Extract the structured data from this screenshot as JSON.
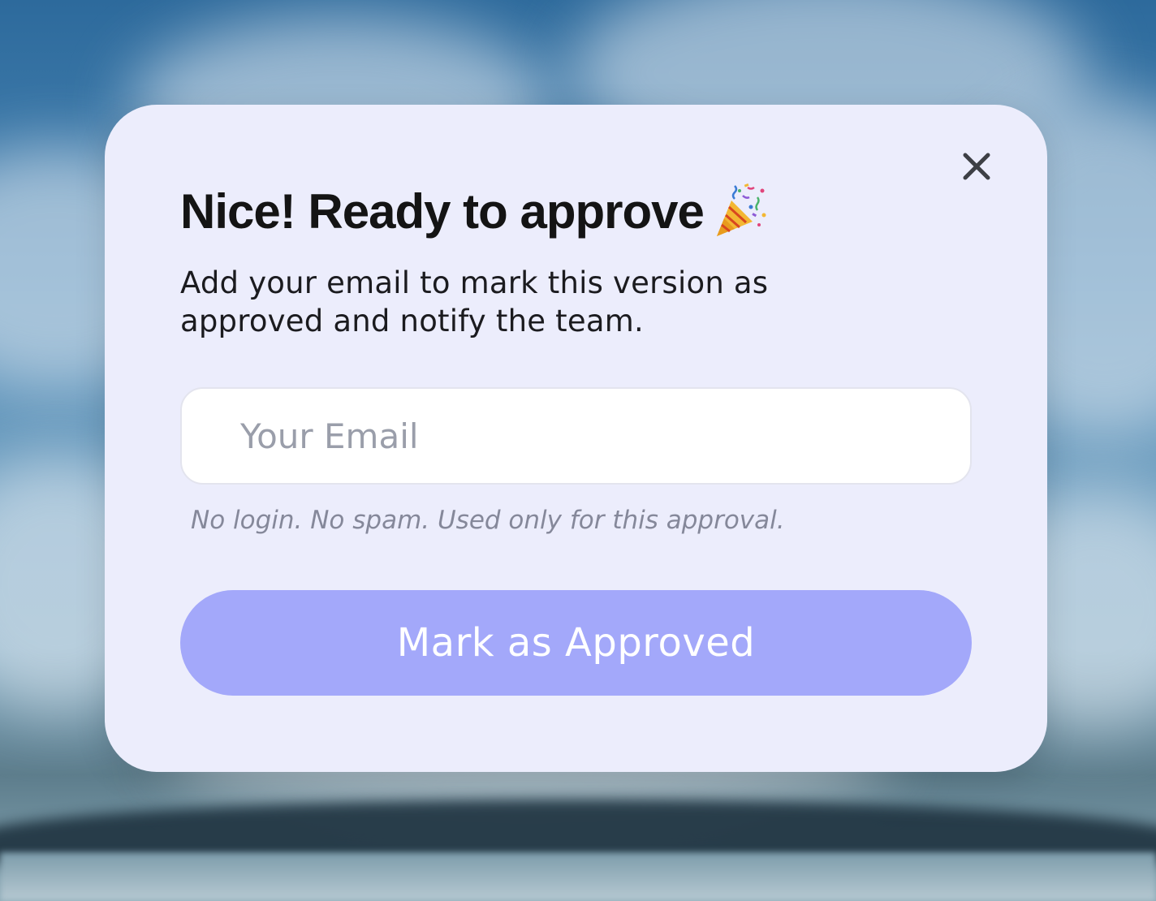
{
  "modal": {
    "title": "Nice! Ready to approve",
    "title_icon": "party-popper-icon",
    "subtitle": "Add your email to mark this version as approved and notify the team.",
    "close_icon": "close-icon",
    "email_field": {
      "value": "",
      "placeholder": "Your Email"
    },
    "helper_text": "No login. No spam. Used only for this approval.",
    "approve_button_label": "Mark as Approved"
  },
  "colors": {
    "modal_background": "#ecedfc",
    "title_text": "#141414",
    "button_background": "#a3a8fa",
    "button_text": "#ffffff",
    "placeholder_text": "#9a9eaa",
    "helper_text": "#85889a"
  }
}
